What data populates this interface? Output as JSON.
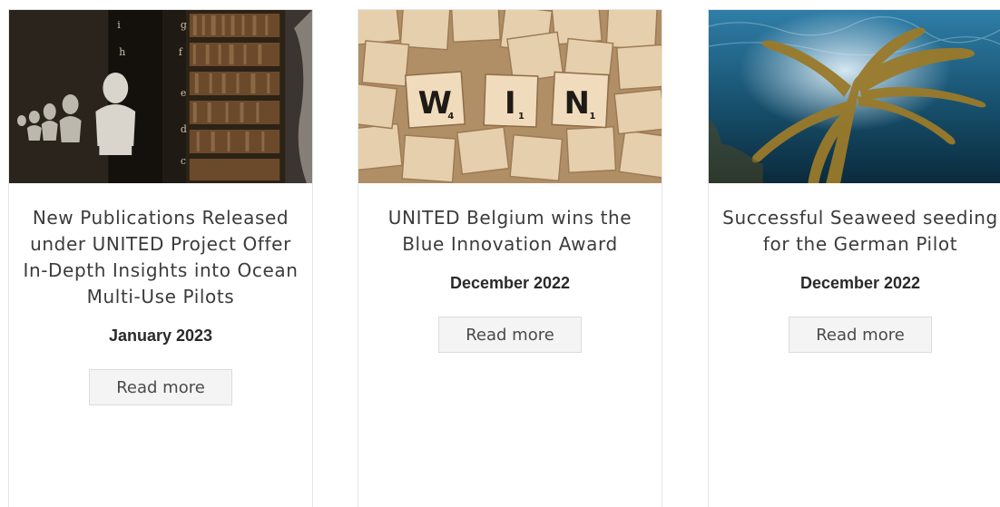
{
  "cards": [
    {
      "image_label": "library-image",
      "title": "New Publications Released under UNITED Project Offer In-Depth Insights into Ocean Multi-Use Pilots",
      "date": "January 2023",
      "button": "Read more"
    },
    {
      "image_label": "win-tiles-image",
      "image_text": {
        "t1": "W",
        "t1_sub": "4",
        "t2": "I",
        "t2_sub": "1",
        "t3": "N",
        "t3_sub": "1"
      },
      "title": "UNITED Belgium wins the Blue Innovation Award",
      "date": "December 2022",
      "button": "Read more"
    },
    {
      "image_label": "seaweed-image",
      "title": "Successful Seaweed seeding for the German Pilot",
      "date": "December 2022",
      "button": "Read more"
    }
  ]
}
